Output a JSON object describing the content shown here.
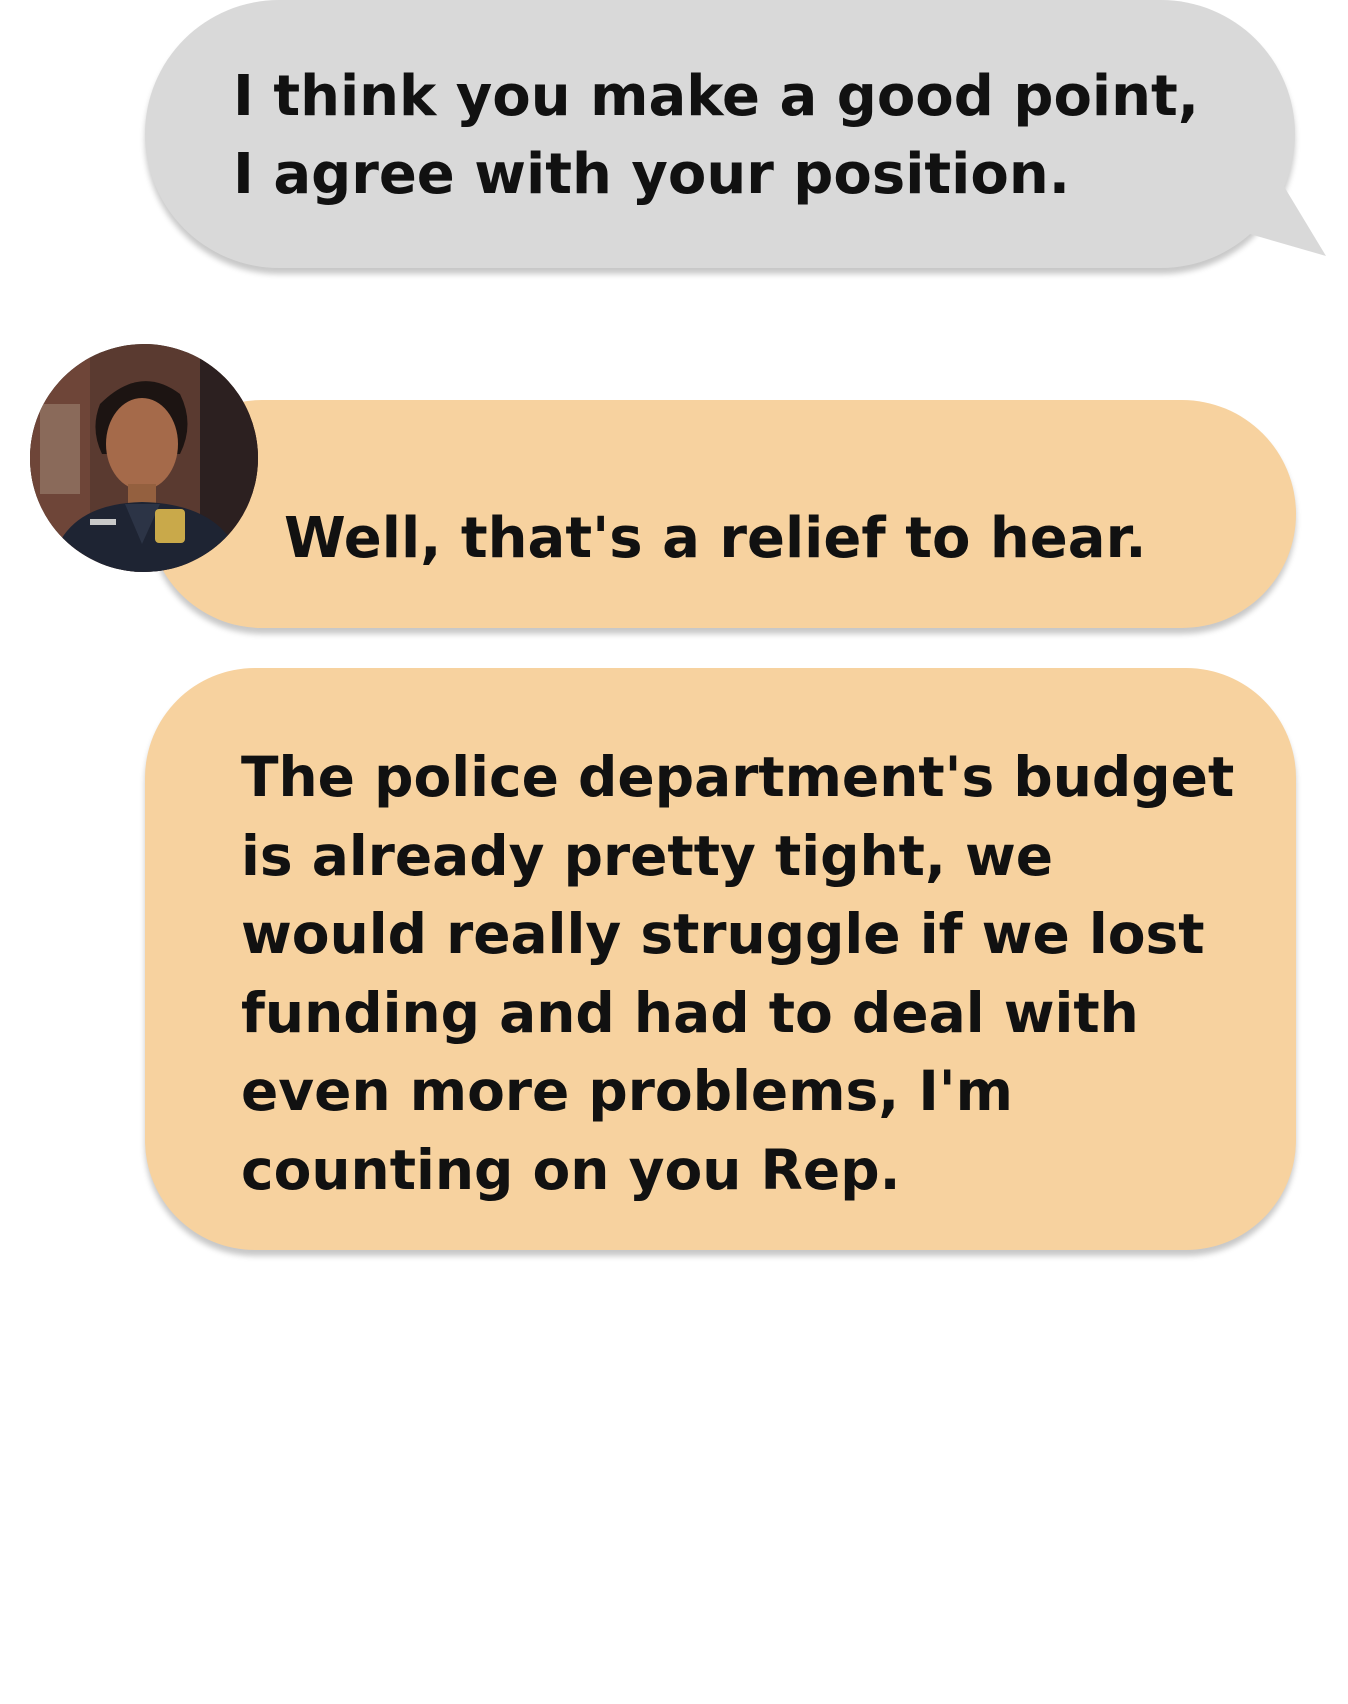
{
  "messages": [
    {
      "sender": "user",
      "text": "I think you make a good point, I agree with your position."
    },
    {
      "sender": "contact",
      "text": "Well, that's a relief to hear."
    },
    {
      "sender": "contact",
      "text": "The police department's budget is already pretty tight, we would really struggle if we lost funding and had to deal with even more problems, I'm counting on you Rep."
    }
  ],
  "colors": {
    "user_bubble": "#d9d9d9",
    "contact_bubble": "#f7d29f",
    "text": "#111111"
  },
  "contact": {
    "avatar_icon": "avatar-photo-icon"
  }
}
